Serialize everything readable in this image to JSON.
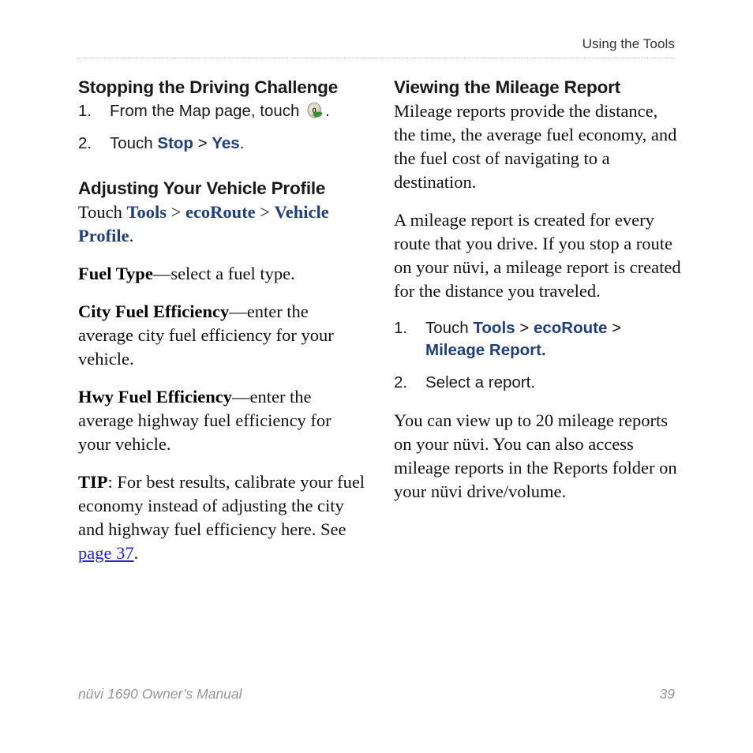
{
  "header": {
    "running_head": "Using the Tools"
  },
  "left_column": {
    "section1": {
      "heading": "Stopping the Driving Challenge",
      "steps": [
        {
          "number": "1.",
          "text_before": "From the Map page, touch",
          "icon": "ecoroute-leaf-gauge-icon",
          "text_after": "."
        },
        {
          "number": "2.",
          "text_before": "Touch ",
          "ui_1": "Stop",
          "sep_1": " > ",
          "ui_2": "Yes",
          "text_after": "."
        }
      ]
    },
    "section2": {
      "heading": "Adjusting Your Vehicle Profile",
      "path_intro": "Touch ",
      "path_1": "Tools",
      "path_sep_1": " > ",
      "path_2": "ecoRoute",
      "path_sep_2": " > ",
      "path_3": "Vehicle Profile",
      "path_end": ".",
      "paragraphs": [
        {
          "term": "Fuel Type",
          "rest": "—select a fuel type."
        },
        {
          "term": "City Fuel Efficiency",
          "rest": "—enter the average city fuel efficiency for your vehicle."
        },
        {
          "term": "Hwy Fuel Efficiency",
          "rest": "—enter the average highway fuel efficiency for your vehicle."
        }
      ],
      "tip": {
        "term": "TIP",
        "text_before": ": For best results, calibrate your fuel economy instead of adjusting the city and highway fuel efficiency here. See ",
        "link": "page 37",
        "text_after": "."
      }
    }
  },
  "right_column": {
    "heading": "Viewing the Mileage Report",
    "paragraph_1": "Mileage reports provide the distance, the time, the average fuel economy, and the fuel cost of navigating to a destination.",
    "paragraph_2": "A mileage report is created for every route that you drive. If you stop a route on your nüvi, a mileage report is created for the distance you traveled.",
    "steps": [
      {
        "number": "1.",
        "text_before": "Touch ",
        "ui_1": "Tools",
        "sep_1": " > ",
        "ui_2": "ecoRoute",
        "sep_2": " > ",
        "ui_3": "Mileage Report.",
        "text_after": ""
      },
      {
        "number": "2.",
        "text": "Select a report."
      }
    ],
    "paragraph_3": "You can view up to 20 mileage reports on your nüvi. You can also access mileage reports in the Reports folder on your nüvi drive/volume."
  },
  "footer": {
    "manual_title": "nüvi 1690 Owner’s Manual",
    "page_number": "39"
  },
  "colors": {
    "ui_blue": "#20407c",
    "link_blue": "#2222dd",
    "rule_gray": "#b9b9b9",
    "footer_gray": "#949494",
    "leaf_green": "#3a9b32"
  }
}
